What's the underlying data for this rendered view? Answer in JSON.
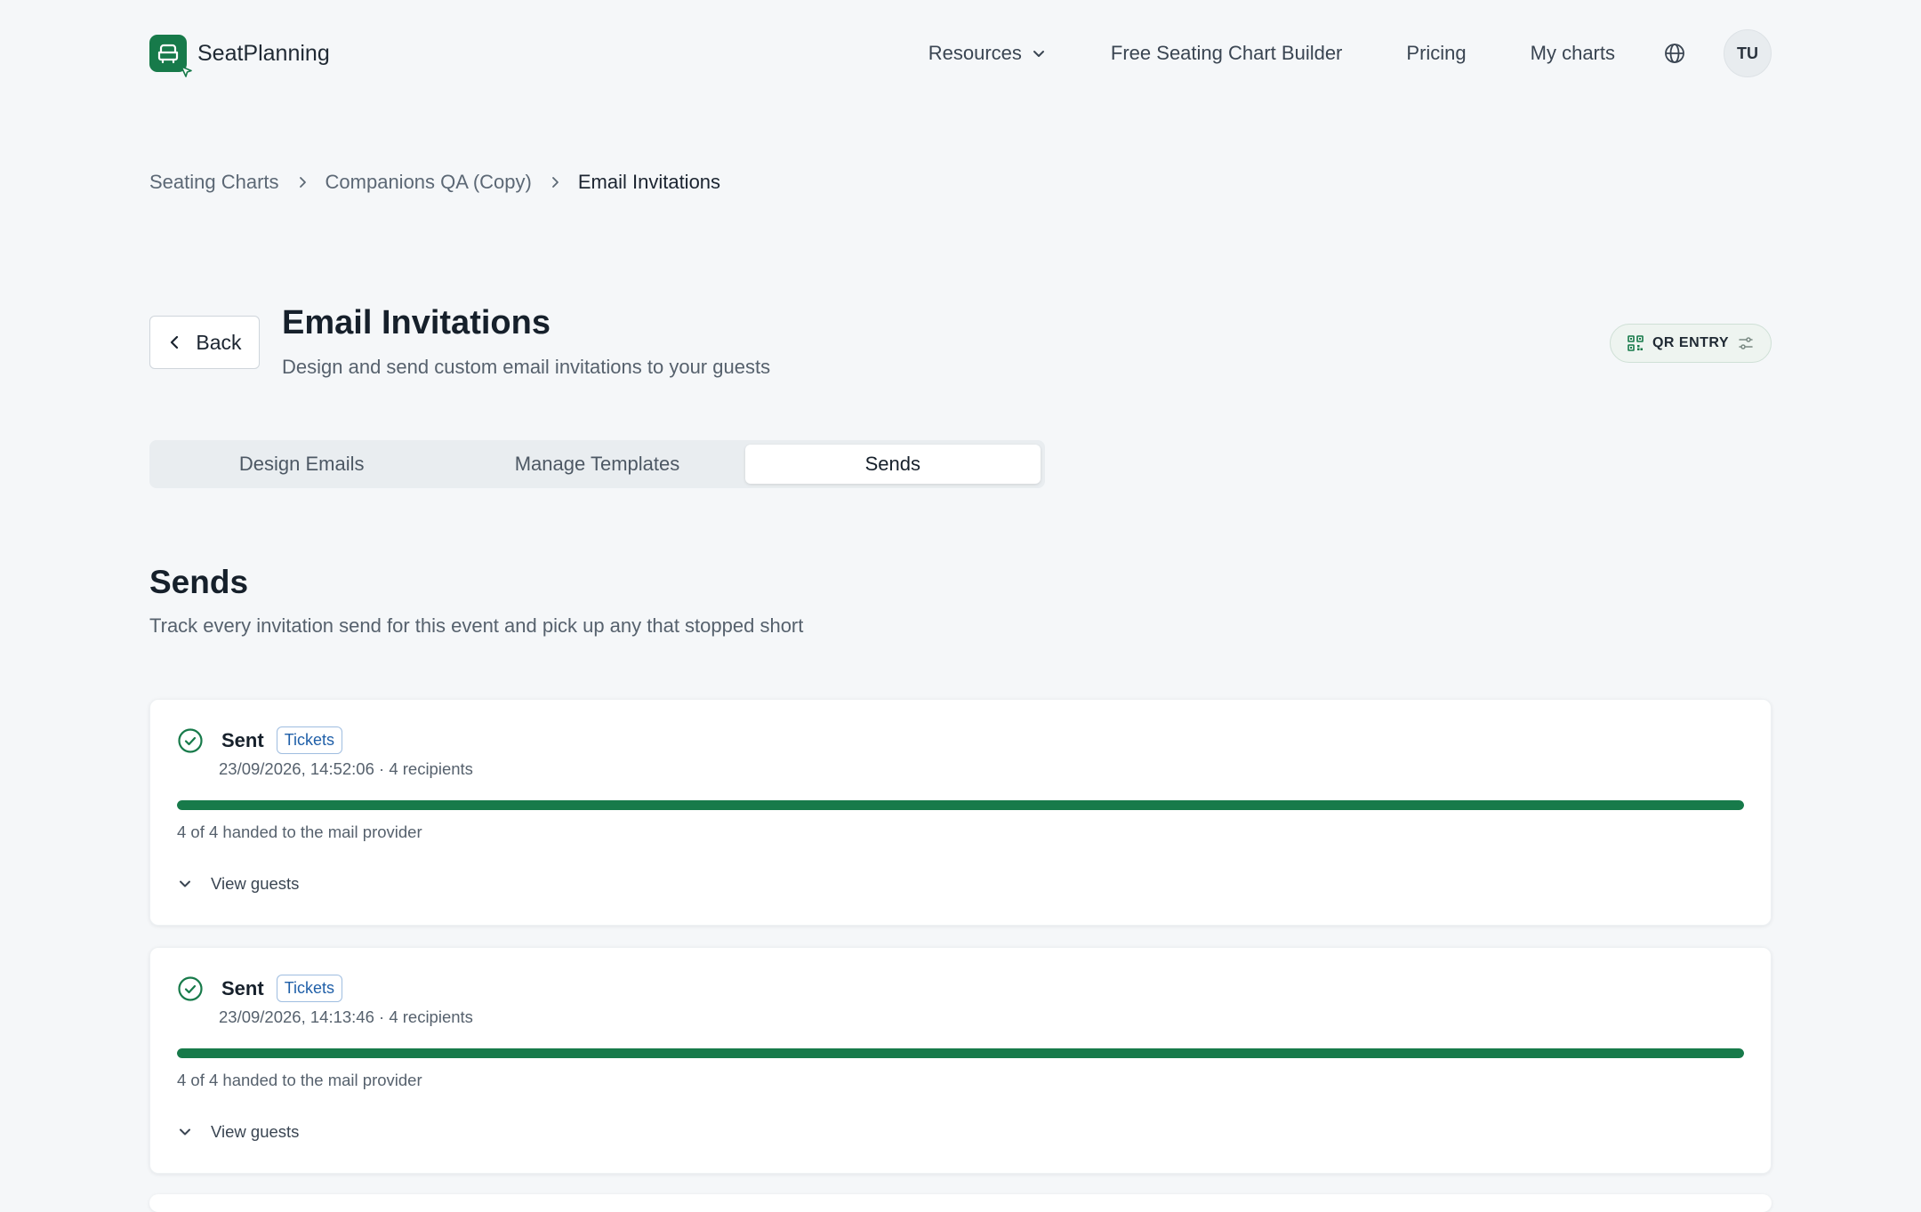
{
  "header": {
    "brand": "SeatPlanning",
    "nav": {
      "resources": "Resources",
      "builder": "Free Seating Chart Builder",
      "pricing": "Pricing",
      "my_charts": "My charts"
    },
    "avatar_initials": "TU"
  },
  "breadcrumb": {
    "item1": "Seating Charts",
    "item2": "Companions QA (Copy)",
    "current": "Email Invitations"
  },
  "page": {
    "back_label": "Back",
    "title": "Email Invitations",
    "subtitle": "Design and send custom email invitations to your guests",
    "qr_entry_label": "QR ENTRY"
  },
  "tabs": [
    {
      "label": "Design Emails",
      "active": false
    },
    {
      "label": "Manage Templates",
      "active": false
    },
    {
      "label": "Sends",
      "active": true
    }
  ],
  "sends": {
    "title": "Sends",
    "subtitle": "Track every invitation send for this event and pick up any that stopped short",
    "items": [
      {
        "status": "Sent",
        "badge": "Tickets",
        "meta": "23/09/2026, 14:52:06 · 4 recipients",
        "progress": 1.0,
        "progress_text": "4 of 4 handed to the mail provider",
        "toggle_label": "View guests"
      },
      {
        "status": "Sent",
        "badge": "Tickets",
        "meta": "23/09/2026, 14:13:46 · 4 recipients",
        "progress": 1.0,
        "progress_text": "4 of 4 handed to the mail provider",
        "toggle_label": "View guests"
      }
    ]
  },
  "colors": {
    "brand_green": "#177a4a",
    "badge_blue": "#1f5fa8",
    "background": "#f5f7f9"
  },
  "icons": {
    "logo": "armchair-icon",
    "resources_dropdown": "chevron-down-icon",
    "language": "globe-icon",
    "breadcrumb_separator": "chevron-right-icon",
    "back": "chevron-left-icon",
    "qr_entry_left": "qr-code-icon",
    "qr_entry_right": "sliders-icon",
    "send_status": "check-circle-icon",
    "expand": "chevron-down-icon"
  }
}
